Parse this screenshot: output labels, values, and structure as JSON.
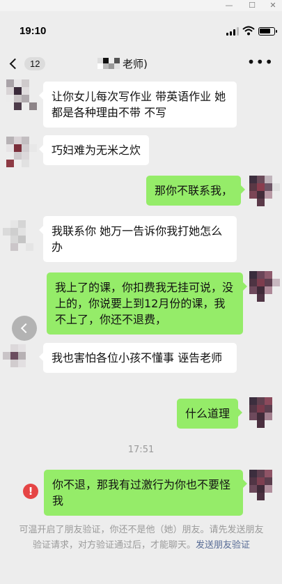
{
  "window": {
    "minimize": "—",
    "maximize": "☐",
    "close": "✕"
  },
  "status_bar": {
    "time": "19:10",
    "battery_level": 0.8
  },
  "header": {
    "unread_count": "12",
    "title": "老师)"
  },
  "messages": [
    {
      "side": "left",
      "text": "让你女儿每次写作业 带英语作业 她都是各种理由不带 不写"
    },
    {
      "side": "left",
      "text": "巧妇难为无米之炊"
    },
    {
      "side": "right",
      "text": "那你不联系我，"
    },
    {
      "side": "left",
      "text": "我联系你 她万一告诉你我打她怎么办"
    },
    {
      "side": "right",
      "text": "我上了的课，你扣费我无挂可说，没上的，你说要上到12月份的课，我不上了，你还不退费，"
    },
    {
      "side": "left",
      "text": "我也害怕各位小孩不懂事  诬告老师"
    },
    {
      "side": "right",
      "text": "什么道理"
    },
    {
      "side": "right",
      "text": "你不退，那我有过激行为你也不要怪我"
    }
  ],
  "timestamp": "17:51",
  "error_icon": "!",
  "system_notice": {
    "text": "可温开启了朋友验证，你还不是他（她）朋友。请先发送朋友验证请求，对方验证通过后，才能聊天。",
    "link": "发送朋友验证"
  },
  "colors": {
    "outgoing_bubble": "#95ec69",
    "incoming_bubble": "#ffffff",
    "background": "#ededed",
    "link": "#576b95",
    "error": "#e54545"
  },
  "icons": [
    "back-chevron-icon",
    "more-icon",
    "signal-icon",
    "wifi-icon",
    "battery-icon",
    "error-icon",
    "scroll-back-icon"
  ]
}
